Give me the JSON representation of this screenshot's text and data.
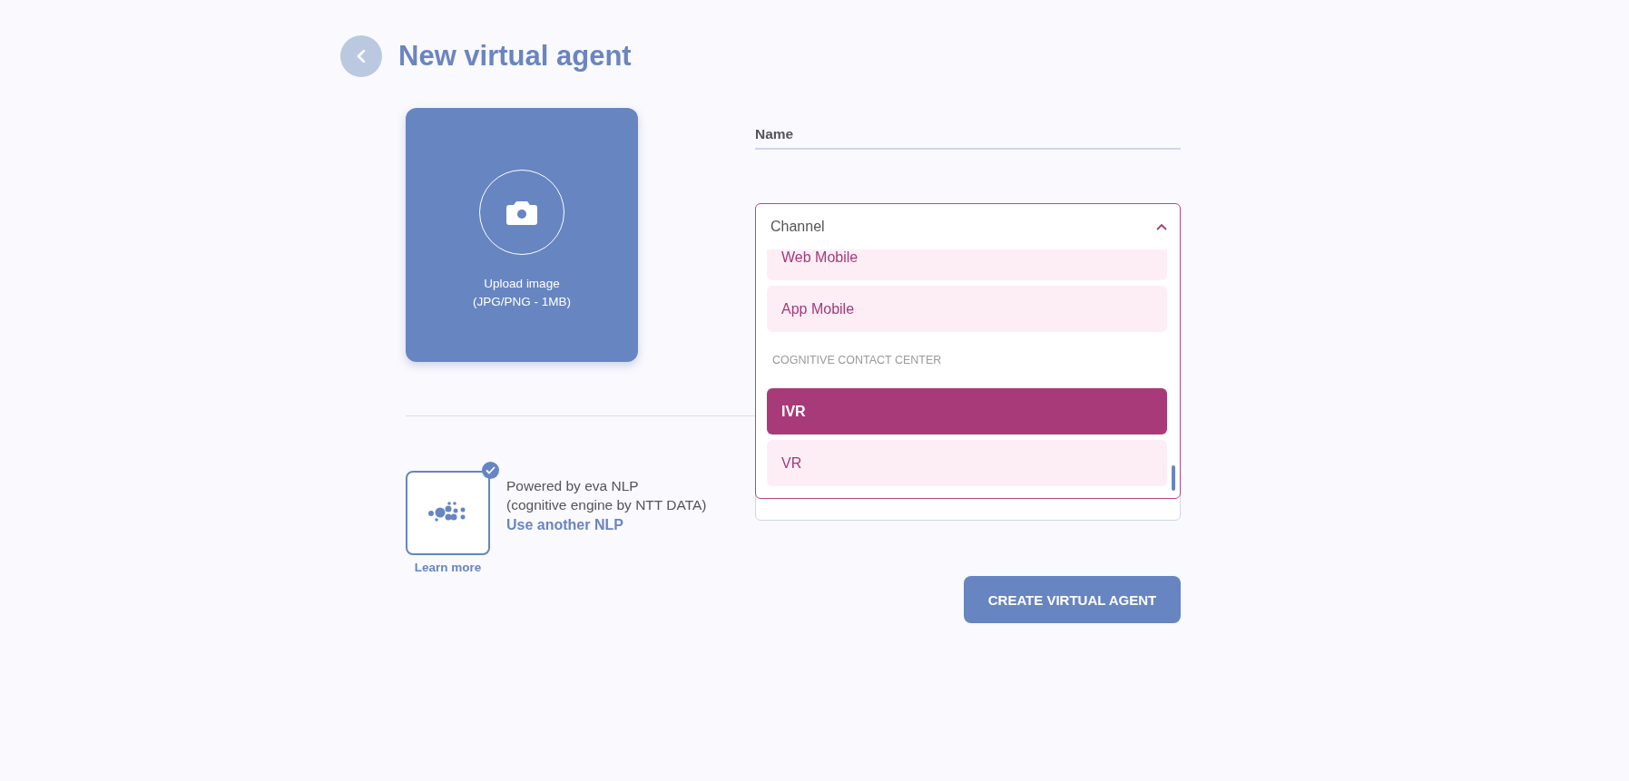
{
  "header": {
    "title": "New virtual agent"
  },
  "upload": {
    "label": "Upload image",
    "hint": "(JPG/PNG - 1MB)"
  },
  "name_field": {
    "label": "Name"
  },
  "channel": {
    "label": "Channel",
    "expanded": true,
    "items": [
      {
        "kind": "option",
        "label": "Web Mobile",
        "selected": false
      },
      {
        "kind": "option",
        "label": "App Mobile",
        "selected": false
      },
      {
        "kind": "group",
        "label": "COGNITIVE CONTACT CENTER"
      },
      {
        "kind": "option",
        "label": "IVR",
        "selected": true
      },
      {
        "kind": "option",
        "label": "VR",
        "selected": false
      }
    ]
  },
  "nlp": {
    "checked": true,
    "title": "Powered by eva NLP",
    "subtitle": "(cognitive engine by NTT DATA)",
    "link": "Use another NLP",
    "learn_more": "Learn more"
  },
  "submit": {
    "label": "CREATE VIRTUAL AGENT"
  }
}
